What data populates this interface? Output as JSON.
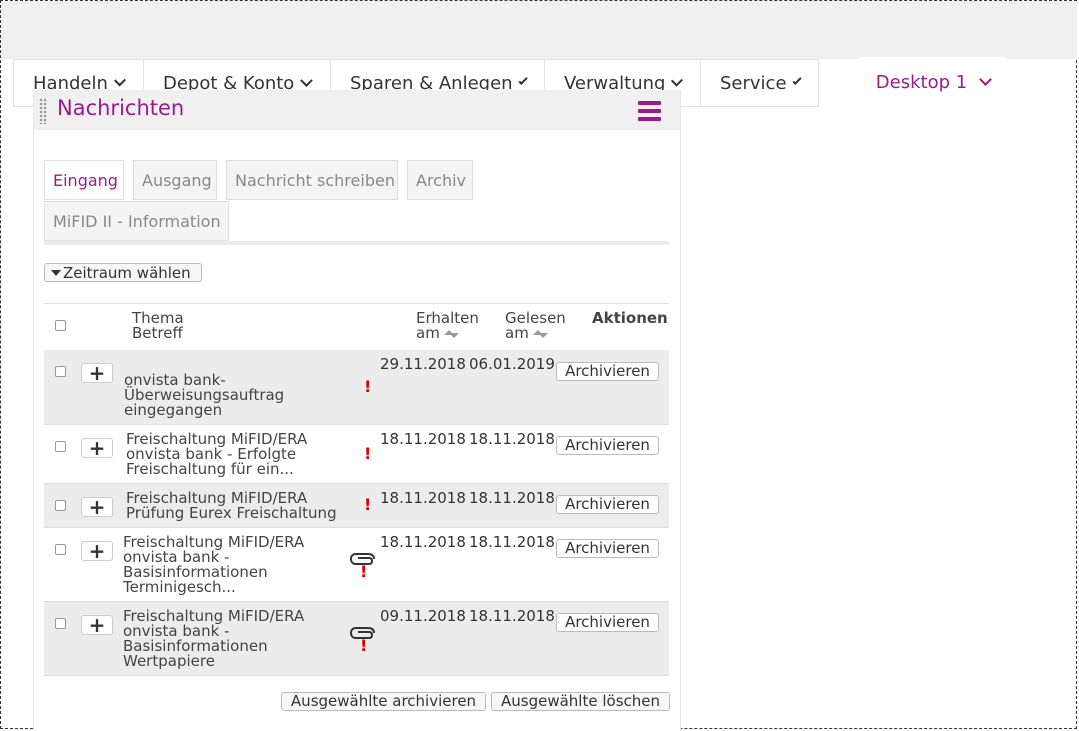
{
  "nav": {
    "items": [
      {
        "label": "Handeln"
      },
      {
        "label": "Depot & Konto"
      },
      {
        "label": "Sparen & Anlegen"
      },
      {
        "label": "Verwaltung"
      },
      {
        "label": "Service"
      }
    ],
    "desktop_tab": "Desktop 1"
  },
  "widget": {
    "title": "Nachrichten",
    "tabs": [
      {
        "label": "Eingang",
        "active": true
      },
      {
        "label": "Ausgang"
      },
      {
        "label": "Nachricht schreiben"
      },
      {
        "label": "Archiv"
      },
      {
        "label": "MiFID II - Information"
      }
    ],
    "zeitraum_label": "Zeitraum wählen",
    "columns": {
      "thema": "Thema",
      "betreff": "Betreff",
      "erhalten_1": "Erhalten",
      "erhalten_2": "am",
      "gelesen_1": "Gelesen",
      "gelesen_2": "am",
      "aktionen": "Aktionen"
    },
    "rows": [
      {
        "lines": [
          "onvista bank-",
          "Überweisungsauftrag",
          "eingegangen"
        ],
        "received": "29.11.2018",
        "read": "06.01.2019",
        "important": "!",
        "attachment": false,
        "action": "Archivieren"
      },
      {
        "lines": [
          "Freischaltung MiFID/ERA",
          "onvista bank - Erfolgte",
          "Freischaltung für ein..."
        ],
        "received": "18.11.2018",
        "read": "18.11.2018",
        "important": "!",
        "attachment": false,
        "action": "Archivieren"
      },
      {
        "lines": [
          "Freischaltung MiFID/ERA",
          "Prüfung Eurex Freischaltung"
        ],
        "received": "18.11.2018",
        "read": "18.11.2018",
        "important": "!",
        "attachment": false,
        "action": "Archivieren"
      },
      {
        "lines": [
          "Freischaltung MiFID/ERA",
          "onvista bank -",
          "Basisinformationen",
          "Terminigesch..."
        ],
        "received": "18.11.2018",
        "read": "18.11.2018",
        "important": "!",
        "attachment": true,
        "action": "Archivieren"
      },
      {
        "lines": [
          "Freischaltung MiFID/ERA",
          "onvista bank -",
          "Basisinformationen",
          "Wertpapiere"
        ],
        "received": "09.11.2018",
        "read": "18.11.2018",
        "important": "!",
        "attachment": true,
        "action": "Archivieren"
      }
    ],
    "footer": {
      "archive_selected": "Ausgewählte archivieren",
      "delete_selected": "Ausgewählte löschen"
    }
  },
  "colors": {
    "accent": "#9b1b8c",
    "important": "#e00000"
  },
  "icons": [
    "chevron-down-icon",
    "grip-icon",
    "menu-icon",
    "caret-down-icon",
    "sort-icon",
    "plus-icon",
    "important-icon",
    "attachment-icon",
    "checkbox"
  ]
}
